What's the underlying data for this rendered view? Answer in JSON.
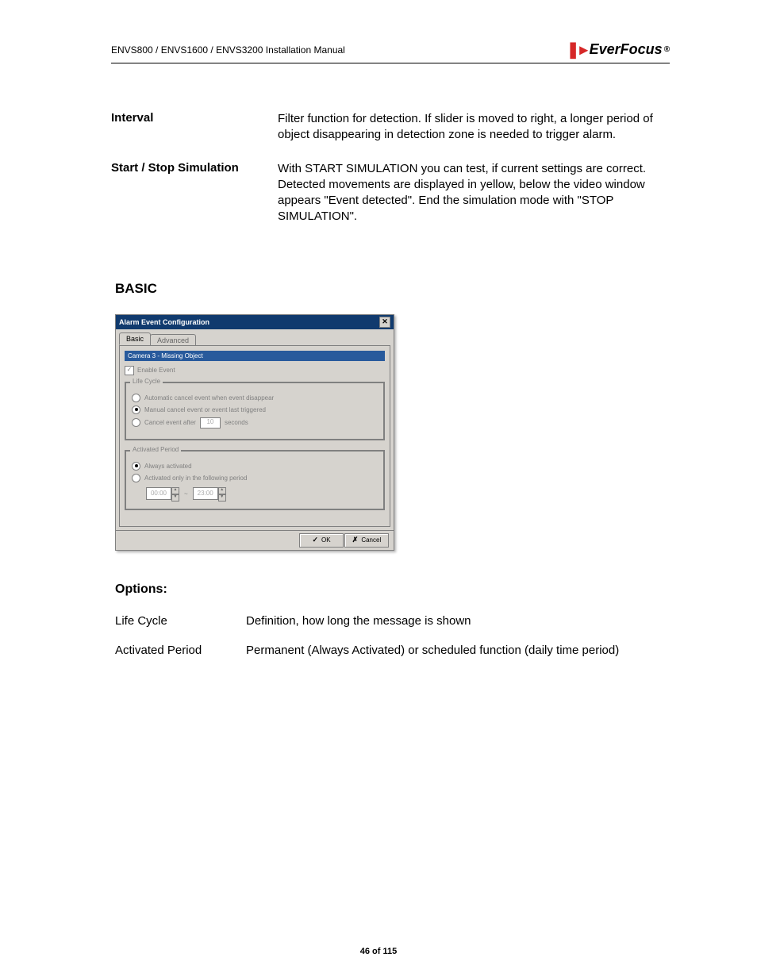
{
  "header": {
    "manual_title": "ENVS800 / ENVS1600 / ENVS3200 Installation Manual",
    "brand": "EverFocus",
    "brand_mark": "®"
  },
  "definitions": [
    {
      "term": "Interval",
      "desc": "Filter function for detection.  If slider is moved to right, a longer period of object disappearing in detection zone  is needed to trigger alarm."
    },
    {
      "term": "Start / Stop Simulation",
      "desc": "With START SIMULATION you can test, if current settings are correct.\nDetected movements are displayed in yellow, below the video window appears \"Event detected\". End the simulation mode with \"STOP SIMULATION\"."
    }
  ],
  "section_heading": "BASIC",
  "dialog": {
    "title": "Alarm Event Configuration",
    "tabs": {
      "basic": "Basic",
      "advanced": "Advanced"
    },
    "camera_label": "Camera 3 - Missing Object",
    "enable_event": {
      "label": "Enable Event",
      "checked": true
    },
    "life_cycle": {
      "legend": "Life Cycle",
      "automatic": "Automatic cancel event when event disappear",
      "manual": "Manual cancel event or event last triggered",
      "cancel_after_pre": "Cancel event after",
      "cancel_after_post": "seconds",
      "cancel_after_value": "10",
      "selected": "manual"
    },
    "activated_period": {
      "legend": "Activated Period",
      "always": "Always activated",
      "only_following": "Activated only in the following period",
      "from": "00:00",
      "to": "23:00",
      "tilde": "~",
      "selected": "always"
    },
    "buttons": {
      "ok": "OK",
      "cancel": "Cancel"
    }
  },
  "options": {
    "heading": "Options:",
    "rows": [
      {
        "term": "Life Cycle",
        "desc": "Definition, how long the message is shown"
      },
      {
        "term": "Activated Period",
        "desc": "Permanent (Always Activated)  or scheduled function (daily time period)"
      }
    ]
  },
  "footer": "46 of 115"
}
